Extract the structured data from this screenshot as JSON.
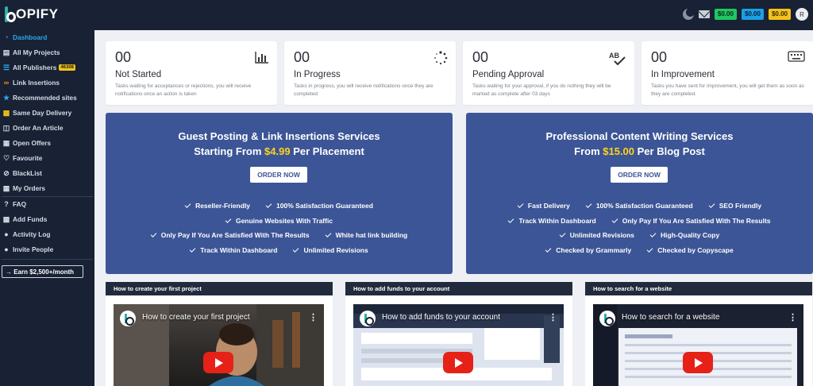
{
  "brand": {
    "name": "OPIFY"
  },
  "topbar": {
    "wallets": [
      {
        "amount": "$0.00",
        "color": "#1fc763"
      },
      {
        "amount": "$0.00",
        "color": "#1a9fe6"
      },
      {
        "amount": "$0.00",
        "color": "#f4c21a"
      }
    ],
    "avatar_initial": "R"
  },
  "sidebar": {
    "items": [
      {
        "label": "Dashboard",
        "icon": "gauge-icon"
      },
      {
        "label": "All My Projects",
        "icon": "folder-icon"
      },
      {
        "label": "All Publishers",
        "icon": "list-icon",
        "badge": "46308"
      },
      {
        "label": "Link Insertions",
        "icon": "link-icon"
      },
      {
        "label": "Recommended sites",
        "icon": "star-icon"
      },
      {
        "label": "Same Day Delivery",
        "icon": "truck-icon"
      },
      {
        "label": "Order An Article",
        "icon": "cart-icon"
      },
      {
        "label": "Open Offers",
        "icon": "offers-icon"
      },
      {
        "label": "Favourite",
        "icon": "heart-icon"
      },
      {
        "label": "BlackList",
        "icon": "ban-icon"
      },
      {
        "label": "My Orders",
        "icon": "orders-icon"
      },
      {
        "label": "FAQ",
        "icon": "question-icon"
      },
      {
        "label": "Add Funds",
        "icon": "wallet-icon"
      },
      {
        "label": "Activity Log",
        "icon": "activity-icon"
      },
      {
        "label": "Invite People",
        "icon": "users-icon"
      }
    ],
    "earn_label": "→ Earn $2,500+/month"
  },
  "stats": [
    {
      "count": "00",
      "title": "Not Started",
      "desc": "Tasks waiting for acceptances or rejections, you will receive notifications once an action is taken",
      "icon": "bar-chart-icon"
    },
    {
      "count": "00",
      "title": "In Progress",
      "desc": "Tasks in progress, you will receive notifications once they are completed",
      "icon": "spinner-icon"
    },
    {
      "count": "00",
      "title": "Pending Approval",
      "desc": "Tasks waiting for your approval, if you do nothing they will be marked as complete after 03 days",
      "icon": "spellcheck-icon"
    },
    {
      "count": "00",
      "title": "In Improvement",
      "desc": "Tasks you have sent for improvement, you will get them as soon as they are completed.",
      "icon": "keyboard-icon"
    }
  ],
  "promos": [
    {
      "title": "Guest Posting & Link Insertions Services",
      "sub_prefix": "Starting From ",
      "price": "$4.99",
      "sub_suffix": " Per Placement",
      "button": "ORDER NOW",
      "feature_rows": [
        [
          "Reseller-Friendly",
          "100% Satisfaction Guaranteed"
        ],
        [
          "Genuine Websites With Traffic"
        ],
        [
          "Only Pay If You Are Satisfied With The Results",
          "White hat link building"
        ],
        [
          "Track Within Dashboard",
          "Unlimited Revisions"
        ]
      ]
    },
    {
      "title": "Professional Content Writing Services",
      "sub_prefix": "From ",
      "price": "$15.00",
      "sub_suffix": " Per Blog Post",
      "button": "ORDER NOW",
      "feature_rows": [
        [
          "Fast Delivery",
          "100% Satisfaction Guaranteed",
          "SEO Friendly"
        ],
        [
          "Track Within Dashboard",
          "Only Pay If You Are Satisfied With The Results"
        ],
        [
          "Unlimited Revisions",
          "High-Quality Copy"
        ],
        [
          "Checked by Grammarly",
          "Checked by Copyscape"
        ]
      ]
    }
  ],
  "videos": [
    {
      "header": "How to create your first project",
      "title": "How to create your first project"
    },
    {
      "header": "How to add funds to your account",
      "title": "How to add funds to your account"
    },
    {
      "header": "How to search for a website",
      "title": "How to search for a website"
    }
  ]
}
